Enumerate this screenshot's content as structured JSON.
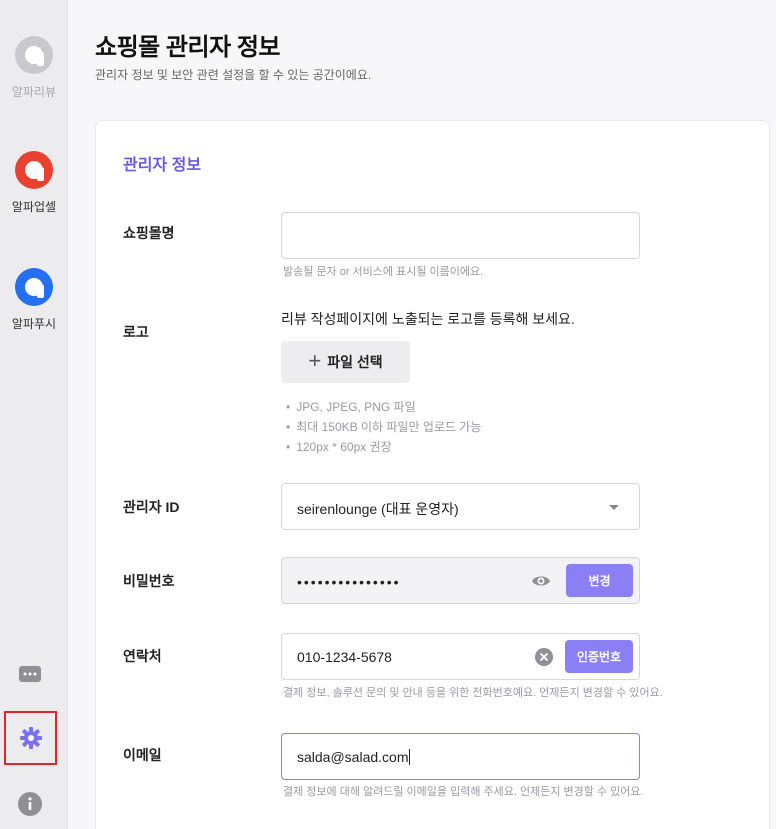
{
  "sidebar": {
    "apps": [
      {
        "label": "알파리뷰",
        "color": "#c9c9cd"
      },
      {
        "label": "알파업셀",
        "color": "#e8412f"
      },
      {
        "label": "알파푸시",
        "color": "#2570f0"
      }
    ],
    "icons": [
      "chat-icon",
      "gear-icon",
      "info-icon"
    ]
  },
  "header": {
    "title": "쇼핑몰 관리자 정보",
    "subtitle": "관리자 정보 및 보안 관련 설정을 할 수 있는 공간이에요."
  },
  "section": {
    "title": "관리자 정보"
  },
  "form": {
    "shop_name": {
      "label": "쇼핑몰명",
      "value": "",
      "help": "발송될 문자 or 서비스에 표시될 이름이에요."
    },
    "logo": {
      "label": "로고",
      "desc": "리뷰 작성페이지에 노출되는 로고를 등록해 보세요.",
      "button": "파일 선택",
      "notes": [
        "JPG, JPEG, PNG 파일",
        "최대 150KB 이하 파일만 업로드 가능",
        "120px * 60px 권장"
      ]
    },
    "admin_id": {
      "label": "관리자 ID",
      "value": "seirenlounge (대표 운영자)"
    },
    "password": {
      "label": "비밀번호",
      "value": "•••••••••••••••",
      "button": "변경"
    },
    "phone": {
      "label": "연락처",
      "value": "010-1234-5678",
      "button": "인증번호",
      "help": "결제 정보, 솔루션 문의 및 안내 등을 위한 전화번호예요. 언제든지 변경할 수 있어요."
    },
    "email": {
      "label": "이메일",
      "value": "salda@salad.com",
      "help": "결제 정보에 대해 알려드릴 이메일을 입력해 주세요. 언제든지 변경할 수 있어요."
    }
  },
  "colors": {
    "accent": "#6b5ae0",
    "button": "#8a7ff5",
    "highlight_border": "#e0262a"
  }
}
